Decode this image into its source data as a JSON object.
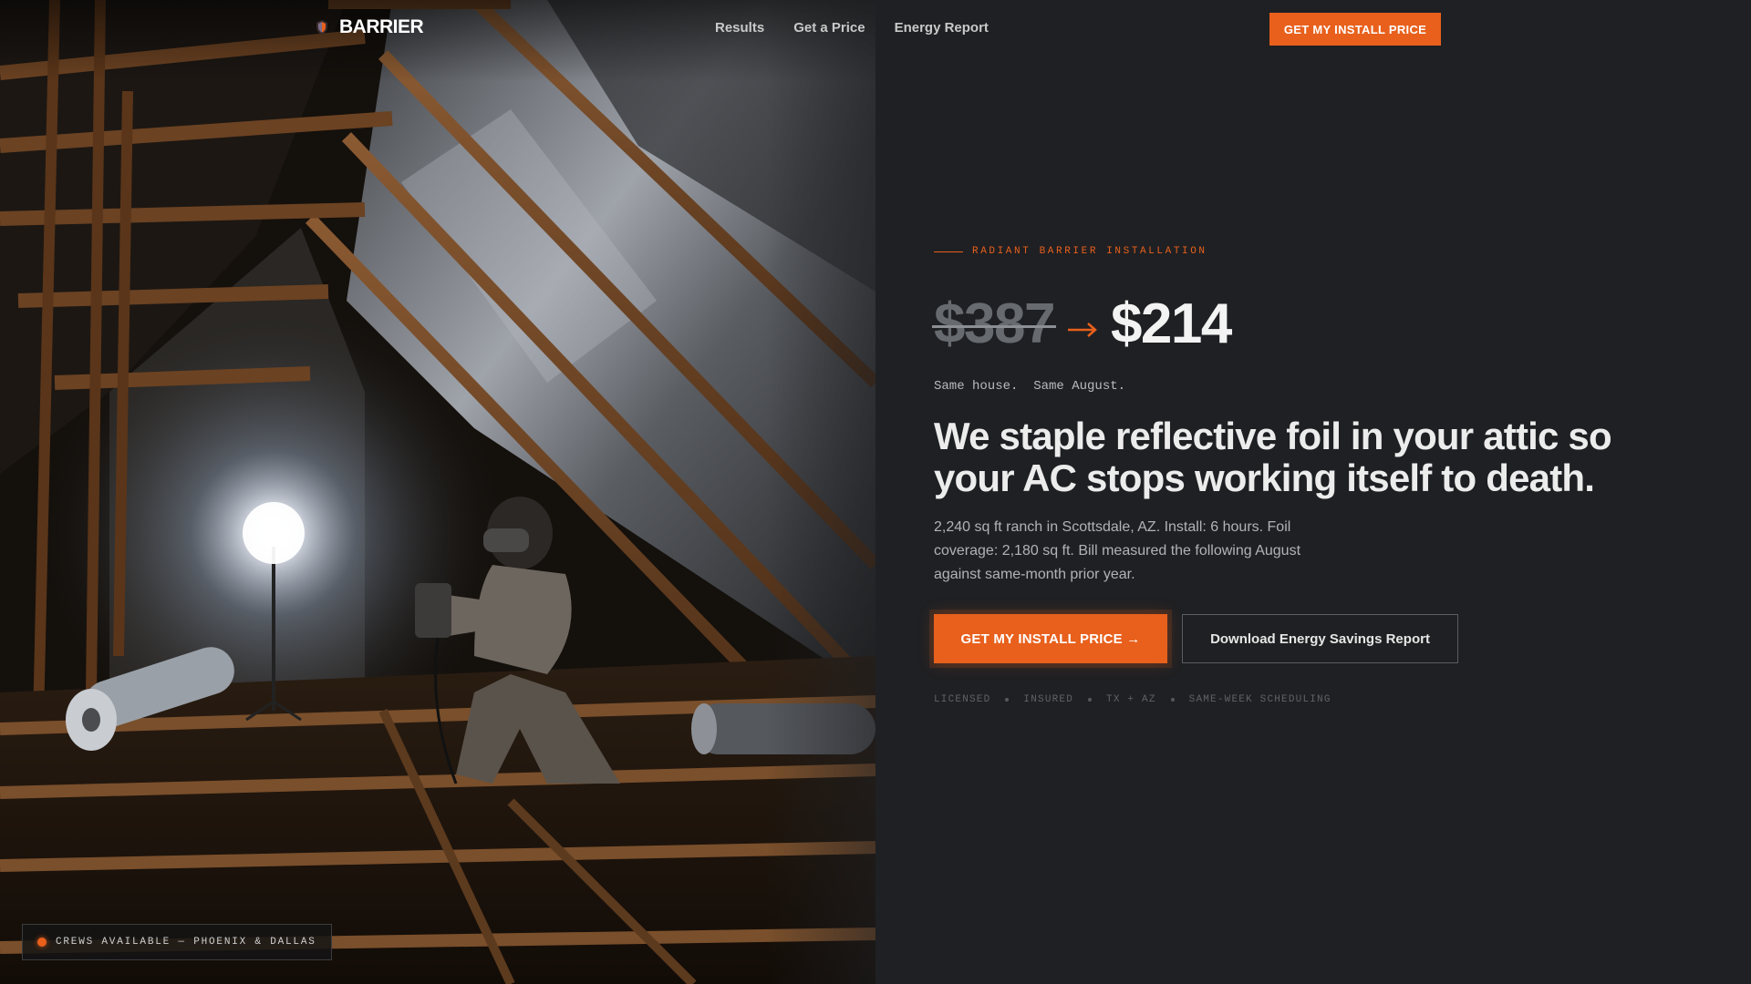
{
  "brand": {
    "name": "BARRIER",
    "accent_color": "#e8601c",
    "logo_icon": "shield-icon"
  },
  "nav": {
    "items": [
      {
        "label": "Results"
      },
      {
        "label": "Get a Price"
      },
      {
        "label": "Energy Report"
      }
    ],
    "cta_label": "GET MY INSTALL PRICE"
  },
  "hero": {
    "eyebrow": "RADIANT BARRIER INSTALLATION",
    "price_old": "$387",
    "price_new": "$214",
    "arrow_icon": "arrow-right-icon",
    "subline": "Same house.  Same August.",
    "headline": "We staple reflective foil in your attic so your AC stops working itself to death.",
    "body": "2,240 sq ft ranch in Scottsdale, AZ. Install: 6 hours. Foil coverage: 2,180 sq ft. Bill measured the following August against same-month prior year.",
    "primary_cta": "GET MY INSTALL PRICE →",
    "secondary_cta": "Download Energy Savings Report",
    "trust": [
      "LICENSED",
      "INSURED",
      "TX + AZ",
      "SAME-WEEK SCHEDULING"
    ]
  },
  "photo": {
    "subject": "attic-installer-photo"
  },
  "badge": {
    "text": "CREWS AVAILABLE — PHOENIX & DALLAS",
    "status_icon": "status-dot-icon"
  }
}
